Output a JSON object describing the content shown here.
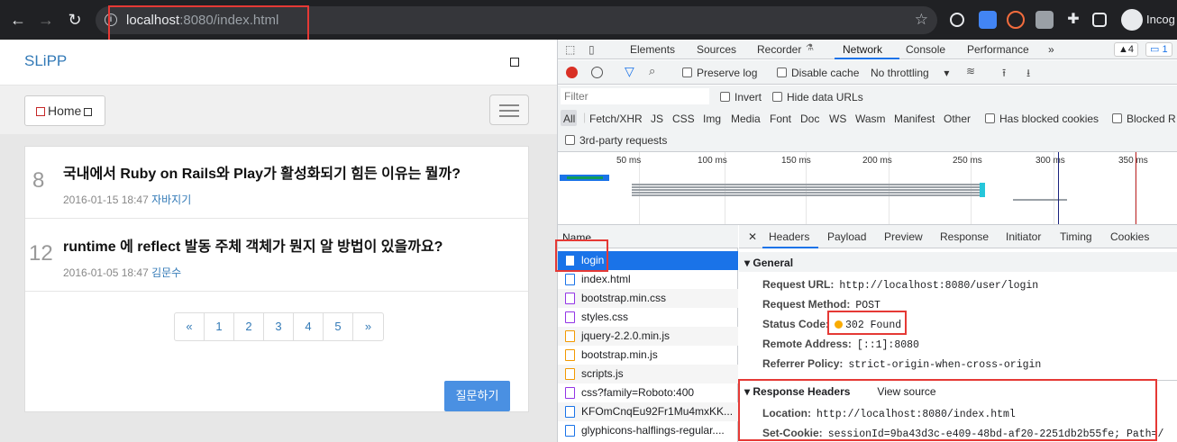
{
  "browser": {
    "back_icon": "arrow-left-icon",
    "url_host": "localhost",
    "url_rest": ":8080/index.html",
    "profile_label": "Incog"
  },
  "page": {
    "brand": "SLiPP",
    "home_label": "Home",
    "questions": [
      {
        "number": "8",
        "title": "국내에서 Ruby on Rails와 Play가 활성화되기 힘든 이유는 뭘까?",
        "date": "2016-01-15 18:47",
        "author": "자바지기"
      },
      {
        "number": "12",
        "title": "runtime 에 reflect 발동 주체 객체가 뭔지 알 방법이 있을까요?",
        "date": "2016-01-05 18:47",
        "author": "김문수"
      }
    ],
    "pagination": [
      "«",
      "1",
      "2",
      "3",
      "4",
      "5",
      "»"
    ],
    "ask_button": "질문하기"
  },
  "devtools": {
    "tabs": [
      "Elements",
      "Sources",
      "Recorder",
      "Network",
      "Console",
      "Performance",
      "»"
    ],
    "active_tab": "Network",
    "warnings_count": "▲4",
    "messages_count": "1",
    "toolbar": {
      "preserve_log": "Preserve log",
      "disable_cache": "Disable cache",
      "throttling": "No throttling"
    },
    "filter": {
      "placeholder": "Filter",
      "invert": "Invert",
      "hide_data_urls": "Hide data URLs"
    },
    "types": [
      "All",
      "Fetch/XHR",
      "JS",
      "CSS",
      "Img",
      "Media",
      "Font",
      "Doc",
      "WS",
      "Wasm",
      "Manifest",
      "Other"
    ],
    "has_blocked_cookies": "Has blocked cookies",
    "blocked_requests": "Blocked R",
    "third_party": "3rd-party requests",
    "timeline_ticks": [
      "50 ms",
      "100 ms",
      "150 ms",
      "200 ms",
      "250 ms",
      "300 ms",
      "350 ms"
    ],
    "name_header": "Name",
    "requests": [
      "login",
      "index.html",
      "bootstrap.min.css",
      "styles.css",
      "jquery-2.2.0.min.js",
      "bootstrap.min.js",
      "scripts.js",
      "css?family=Roboto:400",
      "KFOmCnqEu92Fr1Mu4mxKK...",
      "glyphicons-halflings-regular...."
    ],
    "request_types": [
      "doc",
      "doc",
      "css",
      "css",
      "js",
      "js",
      "js",
      "css",
      "font",
      "font"
    ],
    "selected_request": "login",
    "detail_tabs": [
      "Headers",
      "Payload",
      "Preview",
      "Response",
      "Initiator",
      "Timing",
      "Cookies"
    ],
    "general": {
      "title": "General",
      "request_url_k": "Request URL:",
      "request_url_v": "http://localhost:8080/user/login",
      "request_method_k": "Request Method:",
      "request_method_v": "POST",
      "status_code_k": "Status Code:",
      "status_code_v": "302 Found",
      "remote_address_k": "Remote Address:",
      "remote_address_v": "[::1]:8080",
      "referrer_policy_k": "Referrer Policy:",
      "referrer_policy_v": "strict-origin-when-cross-origin"
    },
    "response_headers": {
      "title": "Response Headers",
      "view_source": "View source",
      "location_k": "Location:",
      "location_v": "http://localhost:8080/index.html",
      "set_cookie_k": "Set-Cookie:",
      "set_cookie_v": "sessionId=9ba43d3c-e409-48bd-af20-2251db2b55fe; Path=/"
    }
  }
}
